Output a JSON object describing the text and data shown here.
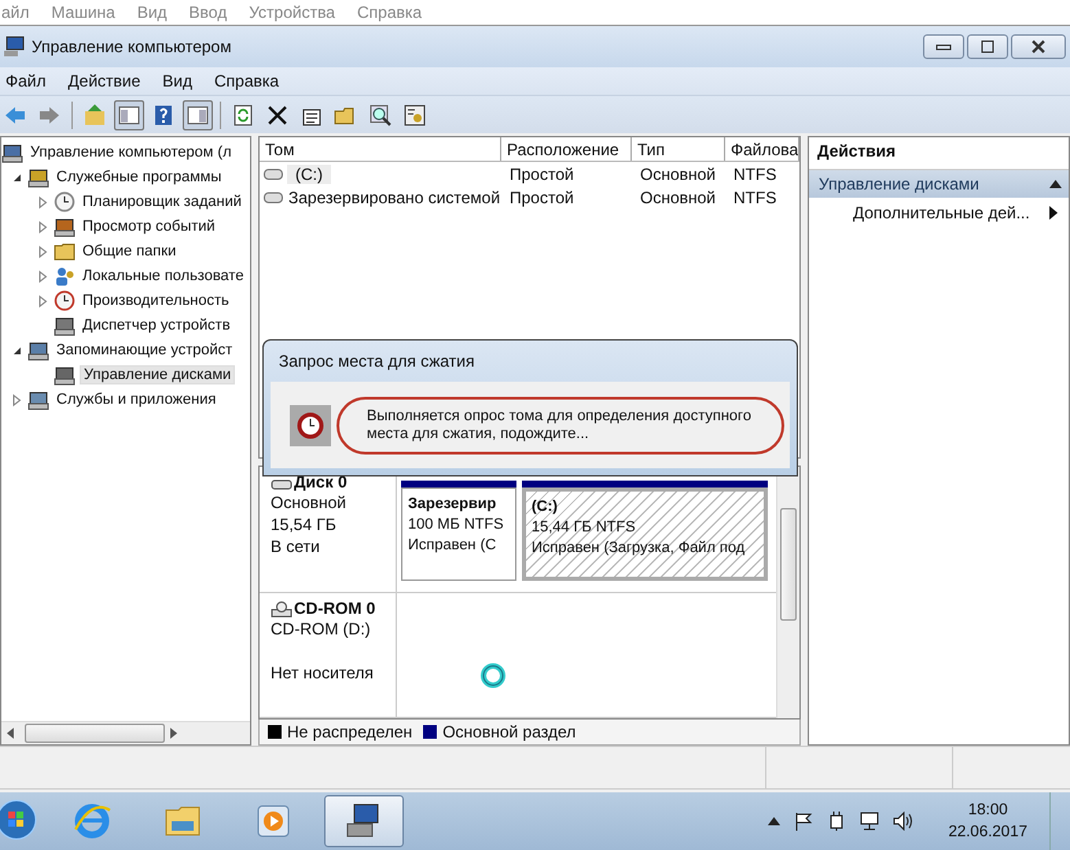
{
  "vm_menu": [
    "айл",
    "Машина",
    "Вид",
    "Ввод",
    "Устройства",
    "Справка"
  ],
  "window": {
    "title": "Управление компьютером"
  },
  "menu": [
    "Файл",
    "Действие",
    "Вид",
    "Справка"
  ],
  "toolbar": [
    {
      "kind": "back",
      "on": false
    },
    {
      "kind": "forward",
      "on": false
    },
    {
      "kind": "up",
      "on": false
    },
    {
      "kind": "tree-pane",
      "on": true
    },
    {
      "kind": "help",
      "on": false
    },
    {
      "kind": "action-pane",
      "on": true
    },
    {
      "kind": "refresh",
      "on": false
    },
    {
      "kind": "delete",
      "on": false
    },
    {
      "kind": "properties",
      "on": false
    },
    {
      "kind": "open",
      "on": false
    },
    {
      "kind": "search",
      "on": false
    },
    {
      "kind": "settings",
      "on": false
    }
  ],
  "tree": [
    {
      "label": "Управление компьютером (л",
      "kind": "computer",
      "selected": false,
      "children": [
        {
          "label": "Служебные программы",
          "kind": "tools",
          "expanded": true,
          "selected": false,
          "children": [
            {
              "label": "Планировщик заданий",
              "kind": "clock",
              "expanded": false,
              "selected": false
            },
            {
              "label": "Просмотр событий",
              "kind": "events",
              "expanded": false,
              "selected": false
            },
            {
              "label": "Общие папки",
              "kind": "folder",
              "expanded": false,
              "selected": false
            },
            {
              "label": "Локальные пользовате",
              "kind": "users",
              "expanded": false,
              "selected": false
            },
            {
              "label": "Производительность",
              "kind": "performance",
              "expanded": false,
              "selected": false
            },
            {
              "label": "Диспетчер устройств",
              "kind": "devices",
              "selected": false
            }
          ]
        },
        {
          "label": "Запоминающие устройст",
          "kind": "storage",
          "expanded": true,
          "selected": false,
          "children": [
            {
              "label": "Управление дисками",
              "kind": "disk",
              "selected": true
            }
          ]
        },
        {
          "label": "Службы и приложения",
          "kind": "services",
          "expanded": false,
          "selected": false
        }
      ]
    }
  ],
  "volumes": {
    "columns": [
      "Том",
      "Расположение",
      "Тип",
      "Файлова"
    ],
    "rows": [
      {
        "cells": [
          "(C:)",
          "Простой",
          "Основной",
          "NTFS"
        ],
        "selected": true
      },
      {
        "cells": [
          "Зарезервировано системой",
          "Простой",
          "Основной",
          "NTFS"
        ],
        "selected": false
      }
    ]
  },
  "disks": [
    {
      "kind": "disk",
      "name": "Диск 0",
      "type": "Основной",
      "size": "15,54 ГБ",
      "status": "В сети",
      "partitions": [
        {
          "name": "Зарезервир",
          "size": "100 МБ NTFS",
          "status": "Исправен (С",
          "selected": false
        },
        {
          "name": "(C:)",
          "size": "15,44 ГБ NTFS",
          "status": "Исправен (Загрузка, Файл под",
          "selected": true
        }
      ]
    },
    {
      "kind": "cdrom",
      "name": "CD-ROM 0",
      "type": "CD-ROM (D:)",
      "status": "Нет носителя",
      "busy": true
    }
  ],
  "legend": [
    {
      "label": "Не распределен",
      "color": "#000000"
    },
    {
      "label": "Основной раздел",
      "color": "#000080"
    }
  ],
  "dialog": {
    "title": "Запрос места для сжатия",
    "message": "Выполняется опрос тома для определения доступного места для сжатия, подождите...",
    "highlighted": true
  },
  "actions": {
    "title": "Действия",
    "section": "Управление дисками",
    "expanded": true,
    "items": [
      "Дополнительные дей..."
    ]
  },
  "taskbar": {
    "apps": [
      {
        "kind": "browser",
        "selected": false
      },
      {
        "kind": "files",
        "selected": false
      },
      {
        "kind": "player",
        "selected": false
      },
      {
        "kind": "management",
        "selected": true
      }
    ],
    "time": "18:00",
    "date": "22.06.2017"
  }
}
